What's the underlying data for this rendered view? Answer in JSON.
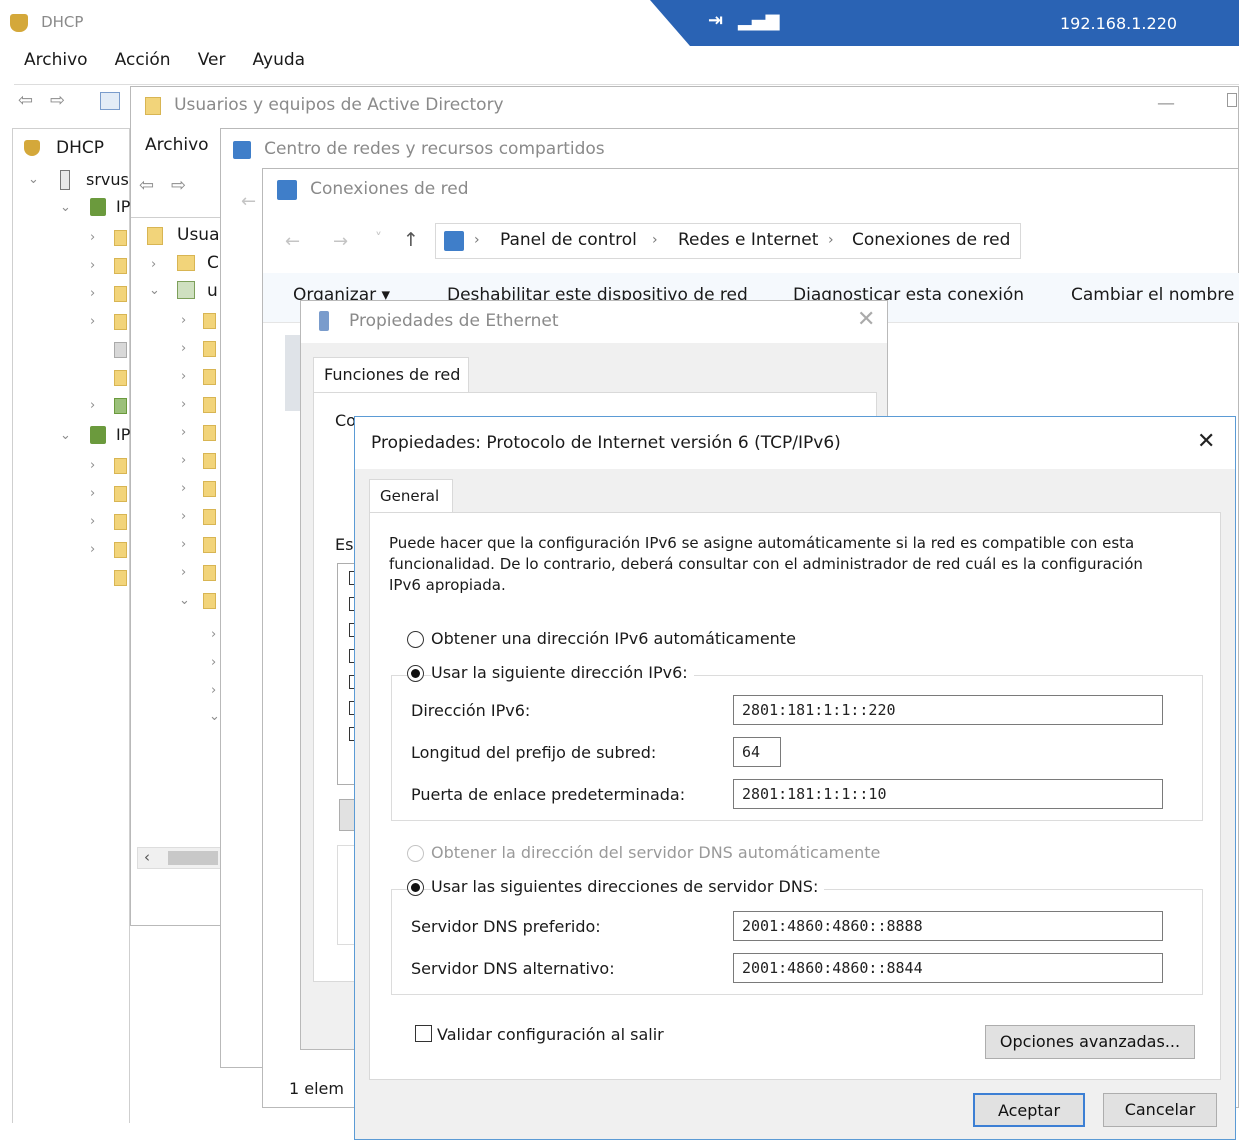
{
  "dhcp": {
    "title": "DHCP",
    "menu": [
      "Archivo",
      "Acción",
      "Ver",
      "Ayuda"
    ],
    "tree_root": "DHCP",
    "tree_server": "srvus",
    "tree_ipv4": "IP",
    "tree_ipv6": "IP"
  },
  "remote_bar": {
    "ip": "192.168.1.220"
  },
  "ad": {
    "title": "Usuarios y equipos de Active Directory",
    "menu_file": "Archivo",
    "tree_root": "Usua",
    "tree_c": "C",
    "tree_u": "u"
  },
  "network_center": {
    "title": "Centro de redes y recursos compartidos"
  },
  "connections": {
    "title": "Conexiones de red",
    "breadcrumb": [
      "Panel de control",
      "Redes e Internet",
      "Conexiones de red"
    ],
    "commands": [
      "Organizar ▾",
      "Deshabilitar este dispositivo de red",
      "Diagnosticar esta conexión",
      "Cambiar el nombre"
    ],
    "status": "1 elem"
  },
  "ethernet": {
    "title": "Propiedades de Ethernet",
    "tab": "Funciones de red",
    "connect_prefix": "Co",
    "items_prefix": "Es"
  },
  "ipv6": {
    "title": "Propiedades: Protocolo de Internet versión 6 (TCP/IPv6)",
    "tab": "General",
    "description": "Puede hacer que la configuración IPv6 se asigne automáticamente si la red es compatible con esta funcionalidad. De lo contrario, deberá consultar con el administrador de red cuál es la configuración IPv6 apropiada.",
    "radio_auto_ip": "Obtener una dirección IPv6 automáticamente",
    "radio_manual_ip": "Usar la siguiente dirección IPv6:",
    "label_address": "Dirección IPv6:",
    "label_prefix": "Longitud del prefijo de subred:",
    "label_gateway": "Puerta de enlace predeterminada:",
    "value_address": "2801:181:1:1::220",
    "value_prefix": "64",
    "value_gateway": "2801:181:1:1::10",
    "radio_auto_dns": "Obtener la dirección del servidor DNS automáticamente",
    "radio_manual_dns": "Usar las siguientes direcciones de servidor DNS:",
    "label_dns_pref": "Servidor DNS preferido:",
    "label_dns_alt": "Servidor DNS alternativo:",
    "value_dns_pref": "2001:4860:4860::8888",
    "value_dns_alt": "2001:4860:4860::8844",
    "validate": "Validar configuración al salir",
    "advanced_btn": "Opciones avanzadas...",
    "ok_btn": "Aceptar",
    "cancel_btn": "Cancelar"
  },
  "colors": {
    "remote_bar": "#2a63b4",
    "folder": "#f2d47a",
    "dialog_border": "#5b9bd5"
  }
}
